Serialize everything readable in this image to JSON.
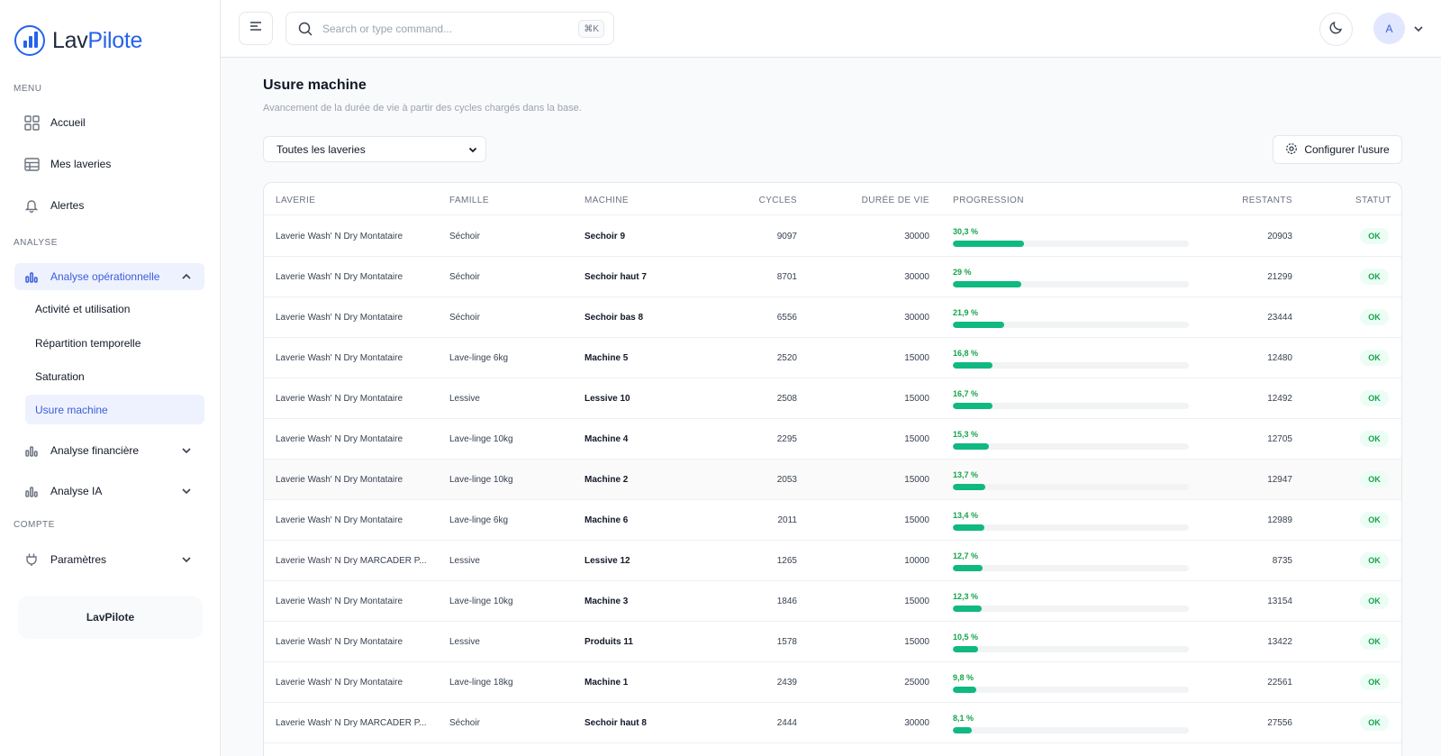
{
  "brand": {
    "name_a": "Lav",
    "name_b": "Pilote"
  },
  "sidebar": {
    "menu_label": "MENU",
    "analyse_label": "ANALYSE",
    "compte_label": "COMPTE",
    "items": [
      {
        "label": "Accueil"
      },
      {
        "label": "Mes laveries"
      },
      {
        "label": "Alertes"
      },
      {
        "label": "Analyse opérationnelle"
      },
      {
        "label": "Analyse financière"
      },
      {
        "label": "Analyse IA"
      },
      {
        "label": "Paramètres"
      }
    ],
    "subitems": [
      {
        "label": "Activité et utilisation"
      },
      {
        "label": "Répartition temporelle"
      },
      {
        "label": "Saturation"
      },
      {
        "label": "Usure machine"
      }
    ],
    "brand_box": "LavPilote"
  },
  "header": {
    "search_placeholder": "Search or type command...",
    "shortcut": "⌘K",
    "avatar": "A"
  },
  "page": {
    "title": "Usure machine",
    "subtitle": "Avancement de la durée de vie à partir des cycles chargés dans la base.",
    "filter_value": "Toutes les laveries",
    "config_button": "Configurer l'usure"
  },
  "table": {
    "headers": {
      "laverie": "LAVERIE",
      "famille": "FAMILLE",
      "machine": "MACHINE",
      "cycles": "CYCLES",
      "duree": "DURÉE DE VIE",
      "progression": "PROGRESSION",
      "restants": "RESTANTS",
      "statut": "STATUT"
    },
    "rows": [
      {
        "laverie": "Laverie Wash' N Dry Montataire",
        "famille": "Séchoir",
        "machine": "Sechoir 9",
        "cycles": "9097",
        "duree": "30000",
        "pct": "30,3 %",
        "fill": 30.3,
        "restants": "20903",
        "statut": "OK"
      },
      {
        "laverie": "Laverie Wash' N Dry Montataire",
        "famille": "Séchoir",
        "machine": "Sechoir haut 7",
        "cycles": "8701",
        "duree": "30000",
        "pct": "29 %",
        "fill": 29,
        "restants": "21299",
        "statut": "OK"
      },
      {
        "laverie": "Laverie Wash' N Dry Montataire",
        "famille": "Séchoir",
        "machine": "Sechoir bas 8",
        "cycles": "6556",
        "duree": "30000",
        "pct": "21,9 %",
        "fill": 21.9,
        "restants": "23444",
        "statut": "OK"
      },
      {
        "laverie": "Laverie Wash' N Dry Montataire",
        "famille": "Lave-linge 6kg",
        "machine": "Machine 5",
        "cycles": "2520",
        "duree": "15000",
        "pct": "16,8 %",
        "fill": 16.8,
        "restants": "12480",
        "statut": "OK"
      },
      {
        "laverie": "Laverie Wash' N Dry Montataire",
        "famille": "Lessive",
        "machine": "Lessive 10",
        "cycles": "2508",
        "duree": "15000",
        "pct": "16,7 %",
        "fill": 16.7,
        "restants": "12492",
        "statut": "OK"
      },
      {
        "laverie": "Laverie Wash' N Dry Montataire",
        "famille": "Lave-linge 10kg",
        "machine": "Machine 4",
        "cycles": "2295",
        "duree": "15000",
        "pct": "15,3 %",
        "fill": 15.3,
        "restants": "12705",
        "statut": "OK"
      },
      {
        "laverie": "Laverie Wash' N Dry Montataire",
        "famille": "Lave-linge 10kg",
        "machine": "Machine 2",
        "cycles": "2053",
        "duree": "15000",
        "pct": "13,7 %",
        "fill": 13.7,
        "restants": "12947",
        "statut": "OK"
      },
      {
        "laverie": "Laverie Wash' N Dry Montataire",
        "famille": "Lave-linge 6kg",
        "machine": "Machine 6",
        "cycles": "2011",
        "duree": "15000",
        "pct": "13,4 %",
        "fill": 13.4,
        "restants": "12989",
        "statut": "OK"
      },
      {
        "laverie": "Laverie Wash' N Dry MARCADER P...",
        "famille": "Lessive",
        "machine": "Lessive 12",
        "cycles": "1265",
        "duree": "10000",
        "pct": "12,7 %",
        "fill": 12.7,
        "restants": "8735",
        "statut": "OK"
      },
      {
        "laverie": "Laverie Wash' N Dry Montataire",
        "famille": "Lave-linge 10kg",
        "machine": "Machine 3",
        "cycles": "1846",
        "duree": "15000",
        "pct": "12,3 %",
        "fill": 12.3,
        "restants": "13154",
        "statut": "OK"
      },
      {
        "laverie": "Laverie Wash' N Dry Montataire",
        "famille": "Lessive",
        "machine": "Produits 11",
        "cycles": "1578",
        "duree": "15000",
        "pct": "10,5 %",
        "fill": 10.5,
        "restants": "13422",
        "statut": "OK"
      },
      {
        "laverie": "Laverie Wash' N Dry Montataire",
        "famille": "Lave-linge 18kg",
        "machine": "Machine 1",
        "cycles": "2439",
        "duree": "25000",
        "pct": "9,8 %",
        "fill": 9.8,
        "restants": "22561",
        "statut": "OK"
      },
      {
        "laverie": "Laverie Wash' N Dry MARCADER P...",
        "famille": "Séchoir",
        "machine": "Sechoir haut 8",
        "cycles": "2444",
        "duree": "30000",
        "pct": "8,1 %",
        "fill": 8.1,
        "restants": "27556",
        "statut": "OK"
      }
    ]
  }
}
